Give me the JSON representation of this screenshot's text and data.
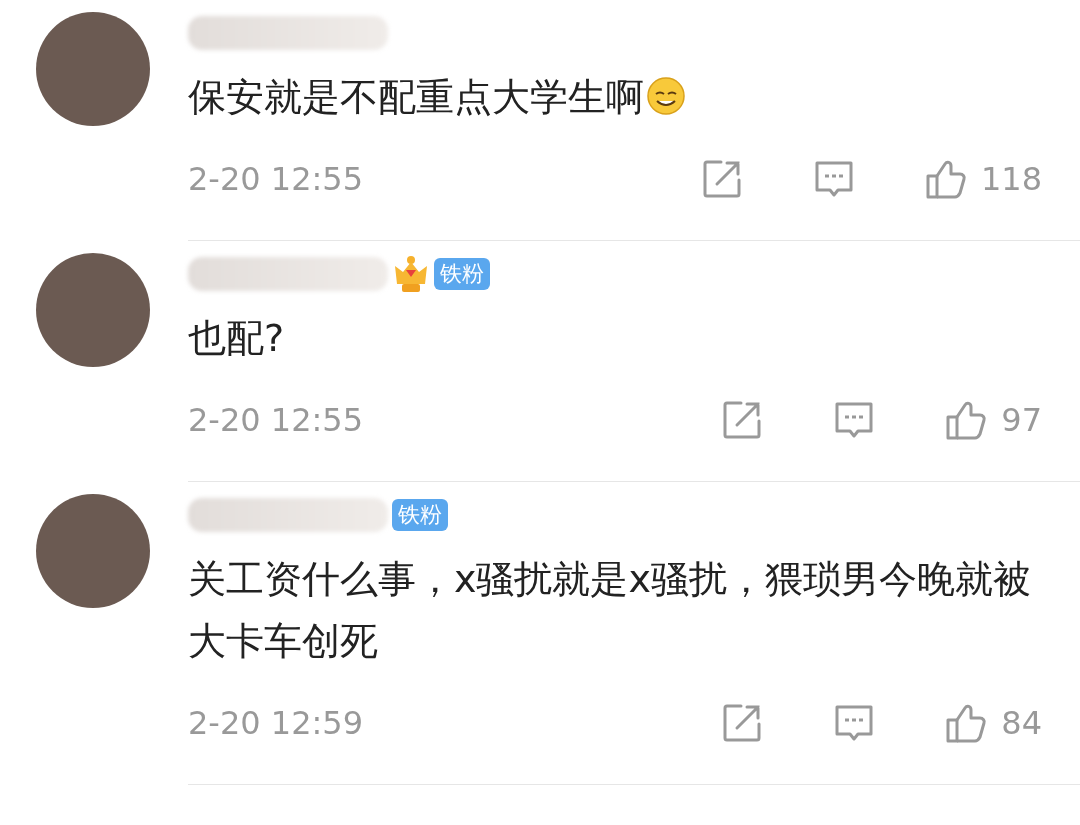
{
  "comments": [
    {
      "text": "保安就是不配重点大学生啊",
      "trailing_emoji": true,
      "time": "2-20 12:55",
      "likes": "118"
    },
    {
      "badges": [
        {
          "kind": "crown"
        },
        {
          "kind": "label",
          "text": "铁粉"
        }
      ],
      "text": "也配?",
      "trailing_emoji": false,
      "time": "2-20 12:55",
      "likes": "97"
    },
    {
      "badges": [
        {
          "kind": "label",
          "text": "铁粉"
        }
      ],
      "text": "关工资什么事，x骚扰就是x骚扰，猥琐男今晚就被大卡车创死",
      "trailing_emoji": false,
      "time": "2-20 12:59",
      "likes": "84"
    }
  ]
}
